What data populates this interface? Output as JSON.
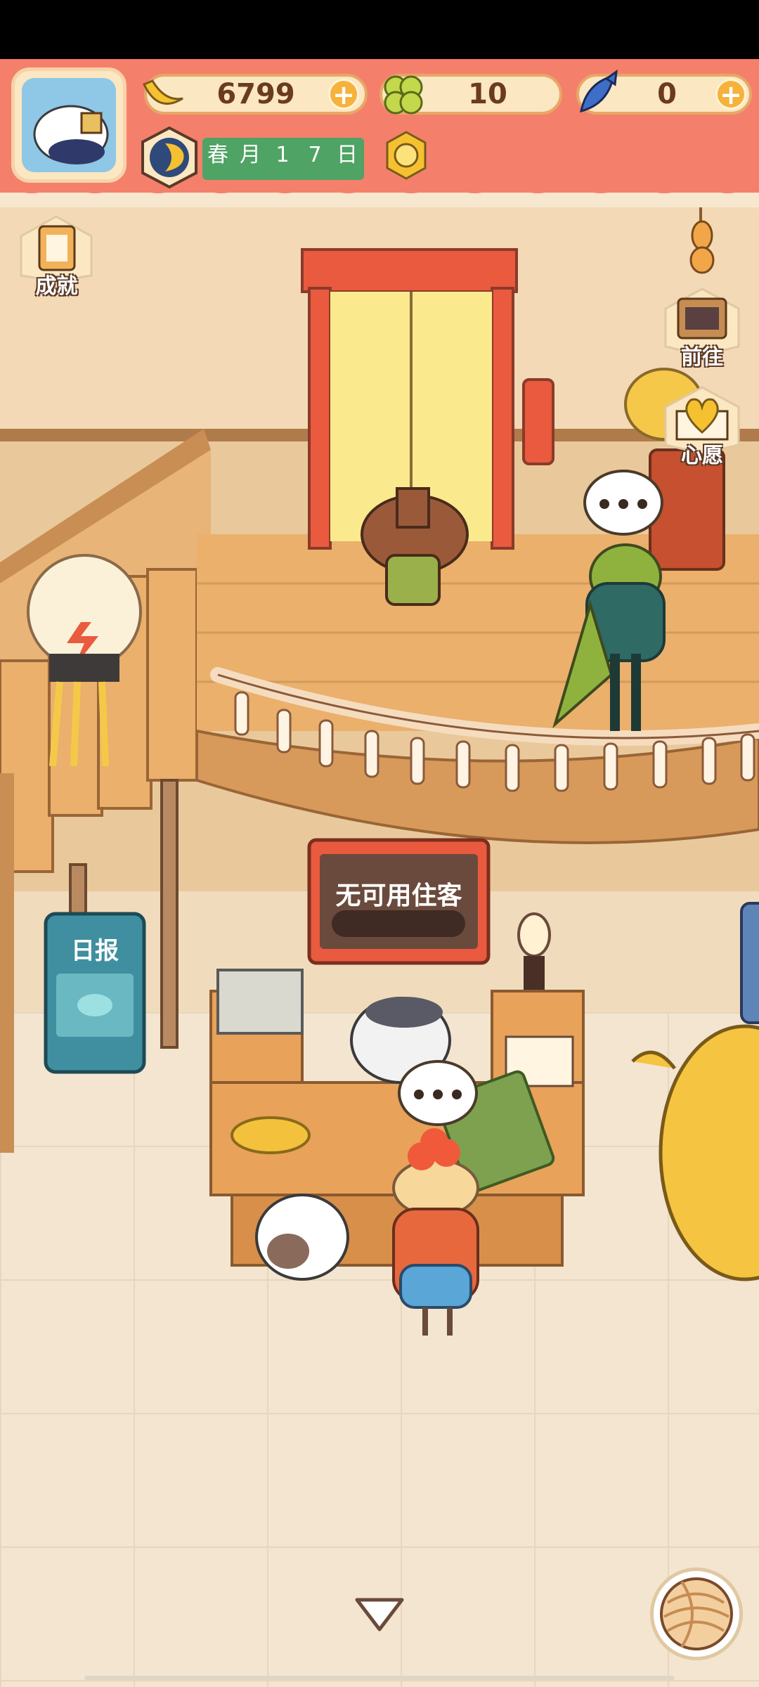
{
  "resources": {
    "bananas": "6799",
    "clover": "10",
    "fish": "0"
  },
  "date": {
    "season": "春",
    "month": "月",
    "day_tens": "1",
    "day_ones": "7",
    "day_suffix": "日"
  },
  "side_buttons": {
    "achievements": "成就",
    "go_to": "前往",
    "wishes": "心愿"
  },
  "scene": {
    "guest_board": "无可用住客",
    "newspaper": "日报"
  },
  "colors": {
    "banner": "#f4806b",
    "accent_green": "#4fa364",
    "wood": "#e3a25c"
  },
  "icons": {
    "avatar": "cat-avatar-icon",
    "banana": "banana-icon",
    "clover": "clover-icon",
    "fish": "fish-icon",
    "moon": "moon-icon",
    "sun": "sun-icon",
    "achievements": "clipboard-icon",
    "go_to": "signboard-icon",
    "wishes": "heart-book-icon",
    "expand": "chevron-down-icon",
    "yarn": "yarn-ball-icon"
  }
}
